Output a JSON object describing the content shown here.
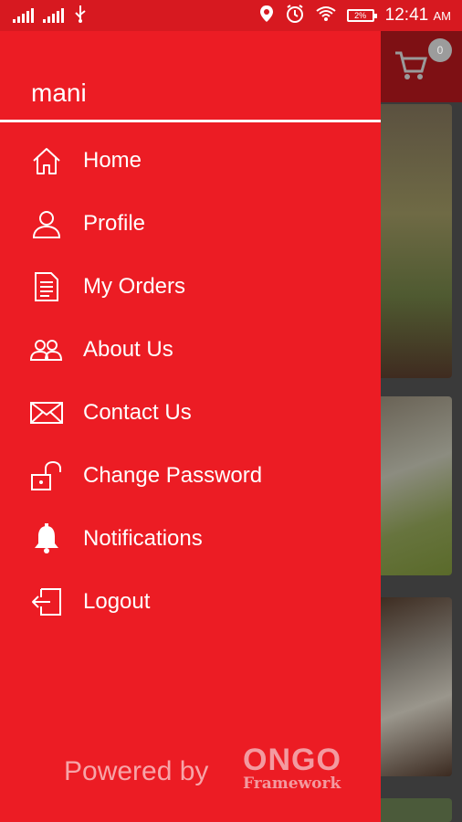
{
  "status_bar": {
    "time": "12:41",
    "ampm": "AM",
    "battery": "2%"
  },
  "background_app": {
    "cart_count": "0"
  },
  "drawer": {
    "user_name": "mani",
    "menu": [
      {
        "label": "Home",
        "icon": "home-icon"
      },
      {
        "label": "Profile",
        "icon": "user-icon"
      },
      {
        "label": "My Orders",
        "icon": "document-icon"
      },
      {
        "label": "About Us",
        "icon": "people-icon"
      },
      {
        "label": "Contact Us",
        "icon": "mail-icon"
      },
      {
        "label": "Change Password",
        "icon": "unlock-icon"
      },
      {
        "label": "Notifications",
        "icon": "bell-icon"
      },
      {
        "label": "Logout",
        "icon": "logout-icon"
      }
    ],
    "powered_by": "Powered by",
    "brand": {
      "main": "ONGO",
      "sub": "Framework"
    }
  },
  "colors": {
    "primary": "#ec1c24",
    "status_bar": "#d71920",
    "muted_text": "#f7a4a8"
  }
}
